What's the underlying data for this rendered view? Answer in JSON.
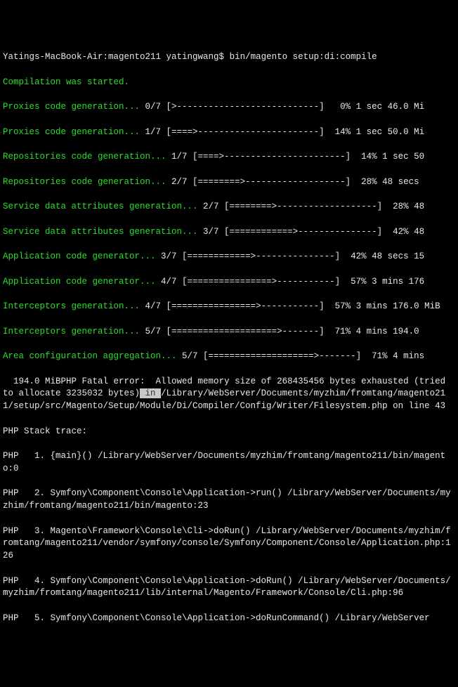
{
  "prompt": {
    "host_path": "Yatings-MacBook-Air:magento211 yatingwang$ ",
    "command": "bin/magento setup:di:compile"
  },
  "lines": [
    {
      "g": "Compilation was started.",
      "w": ""
    },
    {
      "g": "Proxies code generation... ",
      "w": "0/7 [>---------------------------]   0% 1 sec 46.0 Mi"
    },
    {
      "g": "Proxies code generation... ",
      "w": "1/7 [====>-----------------------]  14% 1 sec 50.0 Mi"
    },
    {
      "g": "Repositories code generation... ",
      "w": "1/7 [====>-----------------------]  14% 1 sec 50"
    },
    {
      "g": "Repositories code generation... ",
      "w": "2/7 [========>-------------------]  28% 48 secs"
    },
    {
      "g": "Service data attributes generation... ",
      "w": "2/7 [========>-------------------]  28% 48"
    },
    {
      "g": "Service data attributes generation... ",
      "w": "3/7 [============>---------------]  42% 48"
    },
    {
      "g": "Application code generator... ",
      "w": "3/7 [============>---------------]  42% 48 secs 15"
    },
    {
      "g": "Application code generator... ",
      "w": "4/7 [================>-----------]  57% 3 mins 176"
    },
    {
      "g": "Interceptors generation... ",
      "w": "4/7 [================>-----------]  57% 3 mins 176.0 MiB"
    },
    {
      "g": "Interceptors generation... ",
      "w": "5/7 [====================>-------]  71% 4 mins 194.0"
    },
    {
      "g": "Area configuration aggregation... ",
      "w": "5/7 [====================>-------]  71% 4 mins"
    }
  ],
  "error": {
    "prefix": "  194.0 MiBPHP Fatal error:  Allowed memory size of 268435456 bytes exhausted (tried to allocate 3235032 bytes)",
    "selected": " in ",
    "suffix": "/Library/WebServer/Documents/myzhim/fromtang/magento211/setup/src/Magento/Setup/Module/Di/Compiler/Config/Writer/Filesystem.php on line 43"
  },
  "trace_header": "PHP Stack trace:",
  "trace": [
    "PHP   1. {main}() /Library/WebServer/Documents/myzhim/fromtang/magento211/bin/magento:0",
    "PHP   2. Symfony\\Component\\Console\\Application->run() /Library/WebServer/Documents/myzhim/fromtang/magento211/bin/magento:23",
    "PHP   3. Magento\\Framework\\Console\\Cli->doRun() /Library/WebServer/Documents/myzhim/fromtang/magento211/vendor/symfony/console/Symfony/Component/Console/Application.php:126",
    "PHP   4. Symfony\\Component\\Console\\Application->doRun() /Library/WebServer/Documents/myzhim/fromtang/magento211/lib/internal/Magento/Framework/Console/Cli.php:96",
    "PHP   5. Symfony\\Component\\Console\\Application->doRunCommand() /Library/WebServer"
  ]
}
